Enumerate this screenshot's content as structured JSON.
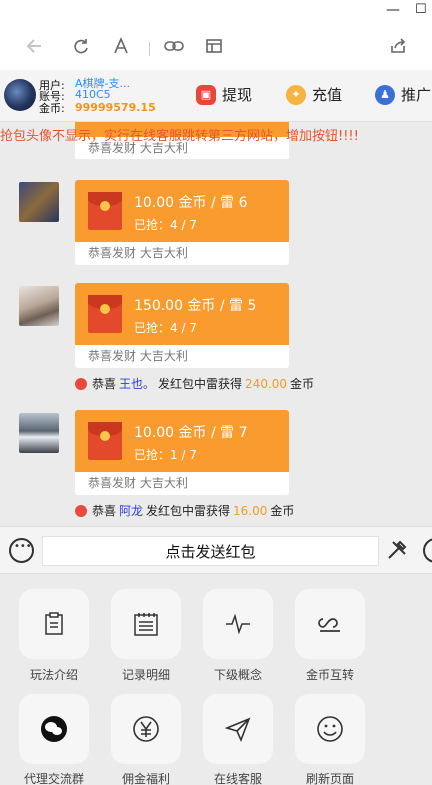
{
  "window": {
    "minimize_glyph": "—",
    "maximize_glyph": "☐"
  },
  "toolbar": {
    "icons": [
      "back-arrow-icon",
      "refresh-icon",
      "font-size-icon",
      "link-icon",
      "reader-icon",
      "share-icon"
    ]
  },
  "user": {
    "name_label": "用户:",
    "account_label": "账号:",
    "coins_label": "金币:",
    "name": "A棋牌-支...",
    "account": "410C5",
    "coins": "99999579.15"
  },
  "nav": {
    "withdraw": "提现",
    "recharge": "充值",
    "promote": "推广"
  },
  "marquee": "抢包头像不显示，实行在线客服跳转第三方网站，增加按钮!!!!",
  "chat": {
    "partial_footer": "恭喜发财 大吉大利",
    "messages": [
      {
        "title": "10.00 金币 / 雷 6",
        "grabbed": "已抢：4 / 7",
        "footer": "恭喜发财 大吉大利"
      },
      {
        "title": "150.00 金币 / 雷 5",
        "grabbed": "已抢：4 / 7",
        "footer": "恭喜发财 大吉大利"
      },
      {
        "title": "10.00 金币 / 雷 7",
        "grabbed": "已抢：1 / 7",
        "footer": "恭喜发财 大吉大利"
      }
    ],
    "notices": [
      {
        "prefix": "恭喜",
        "who": "王也。",
        "middle": "发红包中雷获得",
        "amount": "240.00",
        "suffix": "金币"
      },
      {
        "prefix": "恭喜",
        "who": "阿龙",
        "middle": "发红包中雷获得",
        "amount": "16.00",
        "suffix": "金币"
      }
    ]
  },
  "input": {
    "send_label": "点击发送红包"
  },
  "grid": [
    {
      "label": "玩法介绍",
      "icon": "clipboard-icon",
      "glyph": "📋"
    },
    {
      "label": "记录明细",
      "icon": "record-list-icon",
      "glyph": "☰"
    },
    {
      "label": "下级概念",
      "icon": "pulse-icon",
      "glyph": "〰"
    },
    {
      "label": "金币互转",
      "icon": "transfer-loop-icon",
      "glyph": "∞"
    },
    {
      "label": "代理交流群",
      "icon": "wechat-icon",
      "glyph": "●"
    },
    {
      "label": "佣金福利",
      "icon": "yen-icon",
      "glyph": "¥"
    },
    {
      "label": "在线客服",
      "icon": "send-plane-icon",
      "glyph": "➤"
    },
    {
      "label": "刷新页面",
      "icon": "smile-icon",
      "glyph": "☺"
    }
  ],
  "colors": {
    "accent_orange": "#f99b2f",
    "link_blue": "#2c8bff",
    "coin_orange": "#f7921e",
    "alert_red": "#e8542c"
  }
}
